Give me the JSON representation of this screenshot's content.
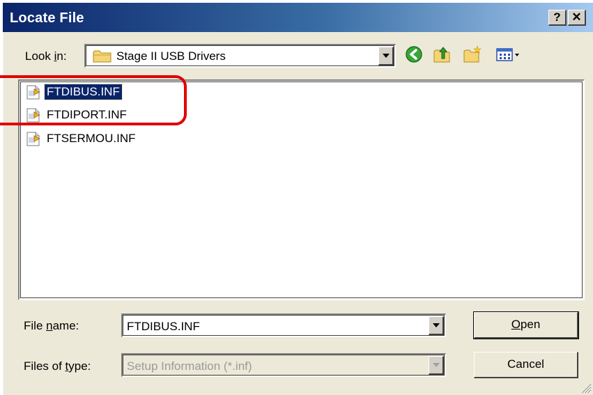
{
  "dialog": {
    "title": "Locate File",
    "help_label": "?",
    "close_label": "✕"
  },
  "lookin": {
    "label_prefix": "Look ",
    "label_access": "i",
    "label_suffix": "n:",
    "value": "Stage II USB Drivers"
  },
  "toolbar": {
    "back_icon": "back-arrow-icon",
    "up_icon": "up-folder-icon",
    "new_folder_icon": "new-folder-icon",
    "views_icon": "views-menu-icon"
  },
  "files": [
    {
      "name": "FTDIBUS.INF",
      "selected": true,
      "icon": "setup-inf-file-icon"
    },
    {
      "name": "FTDIPORT.INF",
      "selected": false,
      "icon": "setup-inf-file-icon"
    },
    {
      "name": "FTSERMOU.INF",
      "selected": false,
      "icon": "setup-inf-file-icon"
    }
  ],
  "filename": {
    "label_prefix": "File ",
    "label_access": "n",
    "label_suffix": "ame:",
    "value": "FTDIBUS.INF"
  },
  "filetype": {
    "label_prefix": "Files of ",
    "label_access": "t",
    "label_suffix": "ype:",
    "value": "Setup Information (*.inf)",
    "disabled": true
  },
  "buttons": {
    "open_access": "O",
    "open_rest": "pen",
    "cancel": "Cancel"
  },
  "colors": {
    "titlebar_start": "#0a246a",
    "titlebar_end": "#a6caf0",
    "selection": "#0a246a",
    "annotation": "#e00000"
  }
}
